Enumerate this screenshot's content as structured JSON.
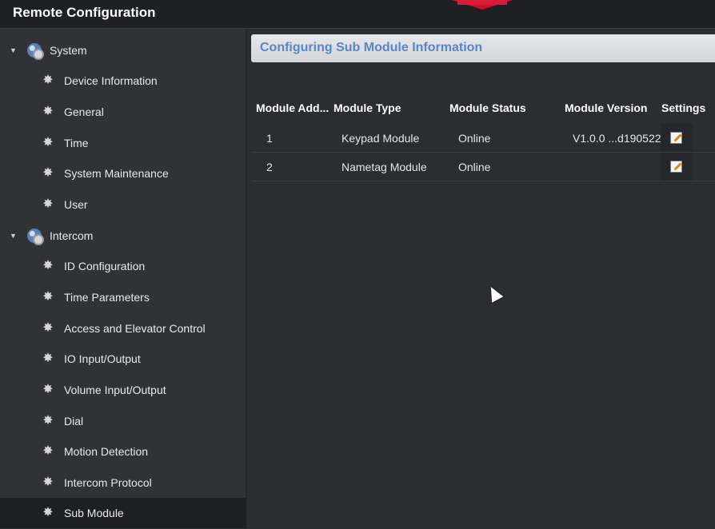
{
  "window": {
    "title": "Remote Configuration"
  },
  "tree": {
    "groups": [
      {
        "label": "System",
        "items": [
          "Device Information",
          "General",
          "Time",
          "System Maintenance",
          "User"
        ]
      },
      {
        "label": "Intercom",
        "items": [
          "ID Configuration",
          "Time Parameters",
          "Access and Elevator Control",
          "IO Input/Output",
          "Volume Input/Output",
          "Dial",
          "Motion Detection",
          "Intercom Protocol",
          "Sub Module"
        ]
      }
    ],
    "selected": "Sub Module"
  },
  "main": {
    "section_title": "Configuring Sub Module Information",
    "table": {
      "headers": [
        "Module Add...",
        "Module Type",
        "Module Status",
        "Module Version",
        "Settings"
      ],
      "rows": [
        {
          "address": "1",
          "type": "Keypad Module",
          "status": "Online",
          "version": "V1.0.0 ...d190522"
        },
        {
          "address": "2",
          "type": "Nametag Module",
          "status": "Online",
          "version": ""
        }
      ]
    }
  }
}
